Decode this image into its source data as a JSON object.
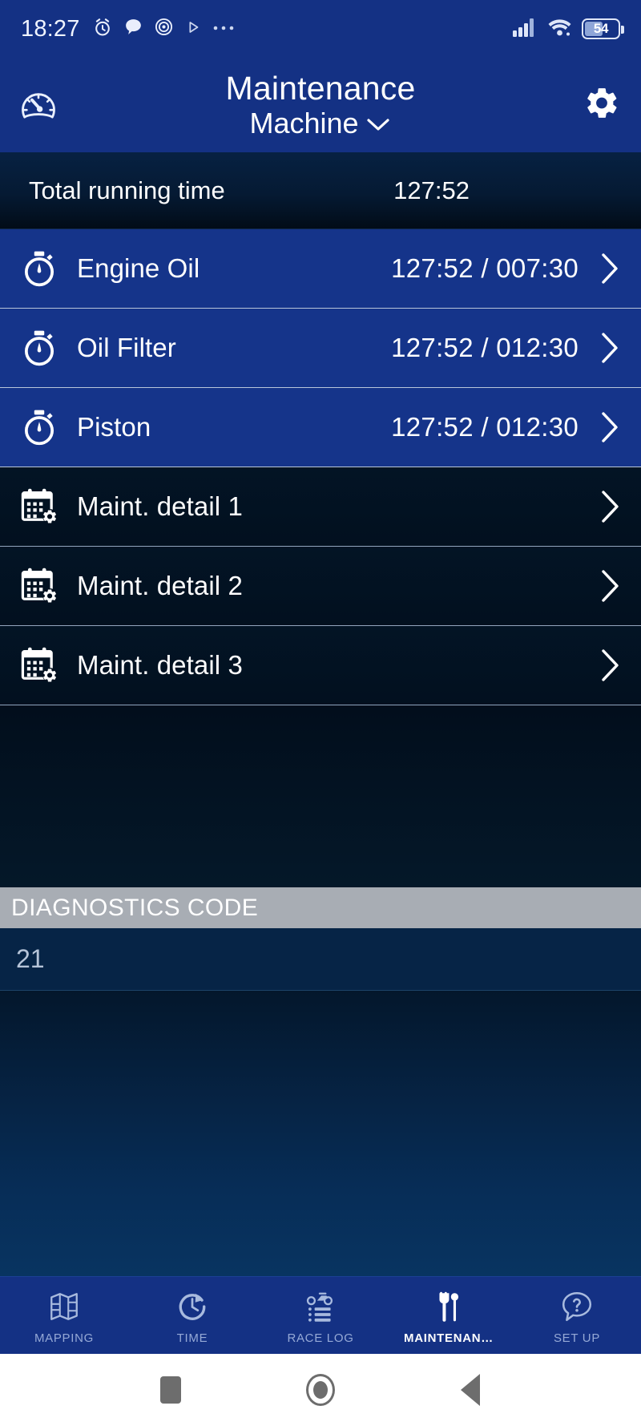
{
  "status_bar": {
    "time": "18:27",
    "battery_percent": "54",
    "icons": [
      "alarm-clock-icon",
      "chat-bubble-icon",
      "target-icon",
      "play-icon",
      "more-dots-icon",
      "cellular-signal-icon",
      "wifi-icon",
      "battery-icon"
    ]
  },
  "app_bar": {
    "title": "Maintenance",
    "subtitle": "Machine",
    "left_icon": "speedometer-icon",
    "right_icon": "gear-icon",
    "dropdown_icon": "chevron-down-icon"
  },
  "total": {
    "label": "Total running time",
    "value": "127:52"
  },
  "maintenance_items": [
    {
      "label": "Engine Oil",
      "value": "127:52 / 007:30",
      "icon": "stopwatch-icon",
      "style": "blue"
    },
    {
      "label": "Oil Filter",
      "value": "127:52 / 012:30",
      "icon": "stopwatch-icon",
      "style": "blue"
    },
    {
      "label": "Piston",
      "value": "127:52 / 012:30",
      "icon": "stopwatch-icon",
      "style": "blue"
    },
    {
      "label": "Maint. detail 1",
      "value": "",
      "icon": "calendar-gear-icon",
      "style": "dark"
    },
    {
      "label": "Maint. detail 2",
      "value": "",
      "icon": "calendar-gear-icon",
      "style": "dark"
    },
    {
      "label": "Maint. detail 3",
      "value": "",
      "icon": "calendar-gear-icon",
      "style": "dark"
    }
  ],
  "diagnostics": {
    "header": "DIAGNOSTICS CODE",
    "codes": [
      "21"
    ]
  },
  "bottom_nav": {
    "items": [
      {
        "label": "MAPPING",
        "icon": "map-icon",
        "active": false
      },
      {
        "label": "TIME",
        "icon": "stopwatch-arrow-icon",
        "active": false
      },
      {
        "label": "RACE LOG",
        "icon": "motorcycle-log-icon",
        "active": false
      },
      {
        "label": "MAINTENAN…",
        "icon": "tools-icon",
        "active": true
      },
      {
        "label": "SET UP",
        "icon": "question-help-icon",
        "active": false
      }
    ]
  },
  "android_nav": {
    "recents": "recents-square-icon",
    "home": "home-circle-icon",
    "back": "back-triangle-icon"
  },
  "colors": {
    "brand_blue": "#143184",
    "row_blue": "#15348a",
    "dark_navy": "#02101f",
    "diag_header_gray": "#a8adb4",
    "accent_white": "#ffffff"
  }
}
